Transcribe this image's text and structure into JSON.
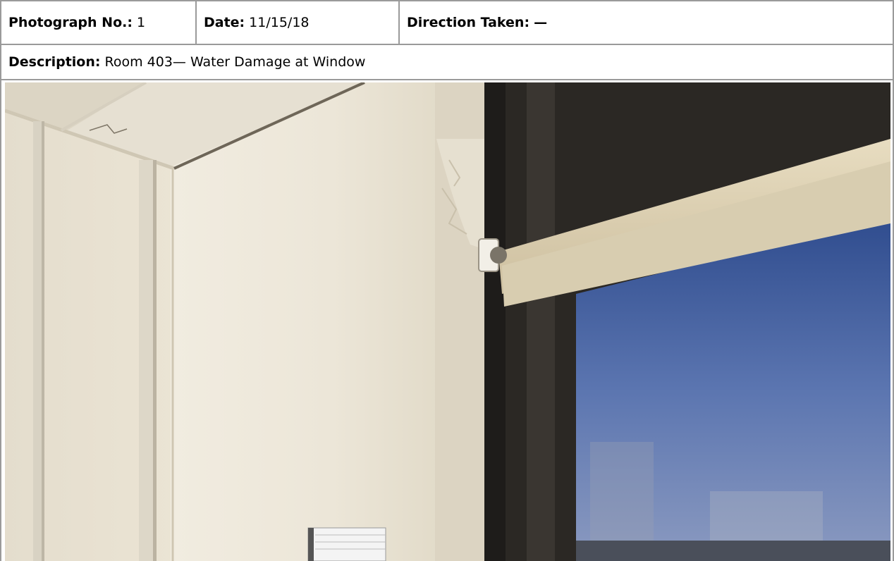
{
  "header": {
    "photo_no_label": "Photograph No.:",
    "photo_no_value": "1",
    "date_label": "Date:",
    "date_value": "11/15/18",
    "direction_label": "Direction Taken:",
    "direction_value": "—"
  },
  "description": {
    "label": "Description:",
    "value": "Room 403— Water Damage at Window"
  },
  "photo": {
    "subject": "Room 403 window corner with water-damaged wall and roller shade"
  }
}
